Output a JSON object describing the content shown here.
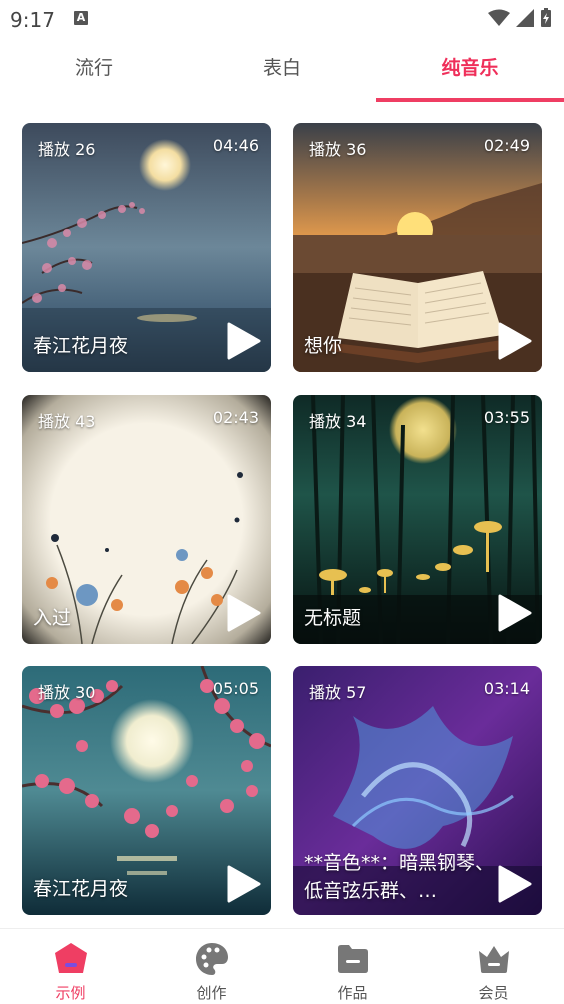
{
  "status": {
    "time": "9:17",
    "indicator": "A"
  },
  "tabs": [
    {
      "label": "流行"
    },
    {
      "label": "表白"
    },
    {
      "label": "纯音乐"
    }
  ],
  "cards": [
    {
      "plays": "播放 26",
      "duration": "04:46",
      "title": "春江花月夜"
    },
    {
      "plays": "播放 36",
      "duration": "02:49",
      "title": "想你"
    },
    {
      "plays": "播放 43",
      "duration": "02:43",
      "title": "入过"
    },
    {
      "plays": "播放 34",
      "duration": "03:55",
      "title": "无标题"
    },
    {
      "plays": "播放 30",
      "duration": "05:05",
      "title": "春江花月夜"
    },
    {
      "plays": "播放 57",
      "duration": "03:14",
      "title": "**音色**：暗黑钢琴、低音弦乐群、…"
    }
  ],
  "nav": [
    {
      "label": "示例",
      "icon": "home-icon"
    },
    {
      "label": "创作",
      "icon": "palette-icon"
    },
    {
      "label": "作品",
      "icon": "folder-icon"
    },
    {
      "label": "会员",
      "icon": "crown-icon"
    }
  ],
  "colors": {
    "accent": "#ef3e63"
  }
}
